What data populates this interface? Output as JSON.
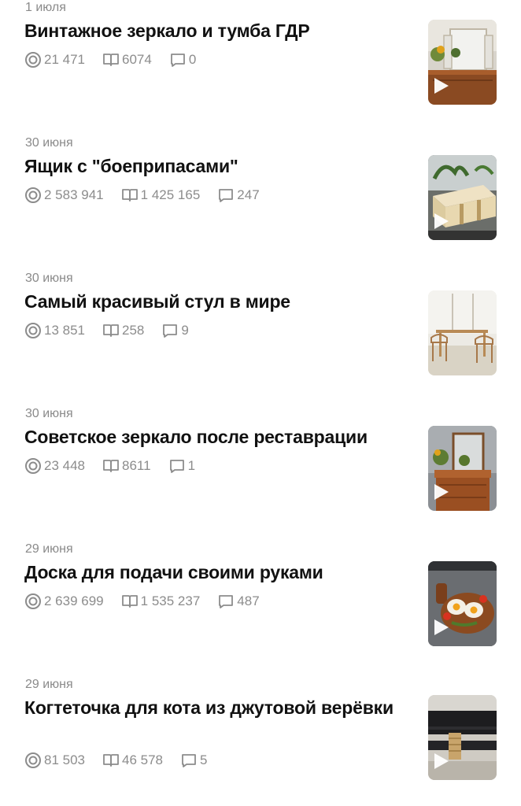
{
  "items": [
    {
      "date": "1 июля",
      "title": "Винтажное зеркало и тумба ГДР",
      "views": "21 471",
      "reads": "6074",
      "comments": "0"
    },
    {
      "date": "30 июня",
      "title": "Ящик с \"боеприпасами\"",
      "views": "2 583 941",
      "reads": "1 425 165",
      "comments": "247"
    },
    {
      "date": "30 июня",
      "title": "Самый красивый стул в мире",
      "views": "13 851",
      "reads": "258",
      "comments": "9"
    },
    {
      "date": "30 июня",
      "title": "Советское зеркало после реставрации",
      "views": "23 448",
      "reads": "8611",
      "comments": "1"
    },
    {
      "date": "29 июня",
      "title": "Доска для подачи своими руками",
      "views": "2 639 699",
      "reads": "1 535 237",
      "comments": "487"
    },
    {
      "date": "29 июня",
      "title": "Когтеточка для кота из джутовой верёвки",
      "views": "81 503",
      "reads": "46 578",
      "comments": "5"
    }
  ],
  "icons": {
    "views": "eye-icon",
    "reads": "book-icon",
    "comments": "comment-icon",
    "play": "play-icon"
  },
  "colors": {
    "title": "#111111",
    "meta": "#8a8a8a",
    "background": "#ffffff"
  }
}
